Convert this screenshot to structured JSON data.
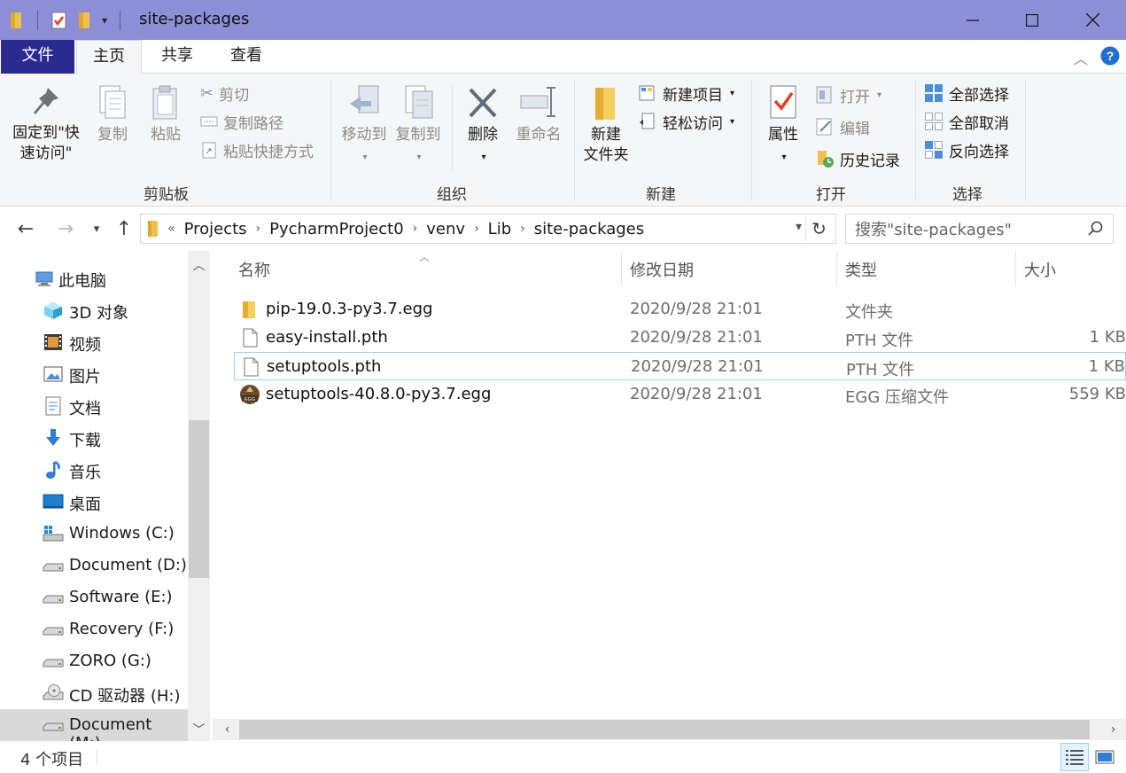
{
  "window": {
    "title": "site-packages",
    "controls": {
      "minimize": "—",
      "maximize": "☐",
      "close": "✕"
    }
  },
  "ribbon_tabs": [
    "文件",
    "主页",
    "共享",
    "查看"
  ],
  "ribbon": {
    "clipboard": {
      "label": "剪贴板",
      "pin_line1": "固定到\"快",
      "pin_line2": "速访问\"",
      "copy": "复制",
      "paste": "粘贴",
      "cut": "剪切",
      "copy_path": "复制路径",
      "paste_shortcut": "粘贴快捷方式"
    },
    "organize": {
      "label": "组织",
      "move_to": "移动到",
      "copy_to": "复制到",
      "delete": "删除",
      "rename": "重命名"
    },
    "new": {
      "label": "新建",
      "new_folder_line1": "新建",
      "new_folder_line2": "文件夹",
      "new_item": "新建项目",
      "easy_access": "轻松访问"
    },
    "open": {
      "label": "打开",
      "properties": "属性",
      "open": "打开",
      "edit": "编辑",
      "history": "历史记录"
    },
    "select": {
      "label": "选择",
      "select_all": "全部选择",
      "select_none": "全部取消",
      "invert": "反向选择"
    }
  },
  "address": {
    "overflow": "«",
    "crumbs": [
      "Projects",
      "PycharmProject0",
      "venv",
      "Lib",
      "site-packages"
    ]
  },
  "search": {
    "placeholder": "搜索\"site-packages\""
  },
  "nav_pane": {
    "items": [
      {
        "label": "此电脑",
        "icon": "pc-icon"
      },
      {
        "label": "3D 对象",
        "icon": "cube-icon"
      },
      {
        "label": "视频",
        "icon": "video-icon"
      },
      {
        "label": "图片",
        "icon": "picture-icon"
      },
      {
        "label": "文档",
        "icon": "document-icon"
      },
      {
        "label": "下载",
        "icon": "download-icon"
      },
      {
        "label": "音乐",
        "icon": "music-icon"
      },
      {
        "label": "桌面",
        "icon": "desktop-icon"
      },
      {
        "label": "Windows (C:)",
        "icon": "windows-drive-icon"
      },
      {
        "label": "Document (D:)",
        "icon": "drive-icon"
      },
      {
        "label": "Software (E:)",
        "icon": "drive-icon"
      },
      {
        "label": "Recovery (F:)",
        "icon": "drive-icon"
      },
      {
        "label": "ZORO (G:)",
        "icon": "drive-icon"
      },
      {
        "label": "CD 驱动器 (H:)",
        "icon": "cd-drive-icon"
      },
      {
        "label": "Document (M:)",
        "icon": "drive-icon"
      }
    ]
  },
  "columns": {
    "name": "名称",
    "modified": "修改日期",
    "type": "类型",
    "size": "大小"
  },
  "files": [
    {
      "name": "pip-19.0.3-py3.7.egg",
      "modified": "2020/9/28 21:01",
      "type": "文件夹",
      "size": "",
      "icon": "folder-icon"
    },
    {
      "name": "easy-install.pth",
      "modified": "2020/9/28 21:01",
      "type": "PTH 文件",
      "size": "1 KB",
      "icon": "file-icon"
    },
    {
      "name": "setuptools.pth",
      "modified": "2020/9/28 21:01",
      "type": "PTH 文件",
      "size": "1 KB",
      "icon": "file-icon"
    },
    {
      "name": "setuptools-40.8.0-py3.7.egg",
      "modified": "2020/9/28 21:01",
      "type": "EGG 压缩文件",
      "size": "559 KB",
      "icon": "egg-archive-icon"
    }
  ],
  "status": {
    "item_count": "4 个项目"
  },
  "colors": {
    "titlebar": "#8c8ed6",
    "file_tab": "#2b2b8f",
    "selection": "#cce8ff",
    "folder": "#f0c24b"
  }
}
